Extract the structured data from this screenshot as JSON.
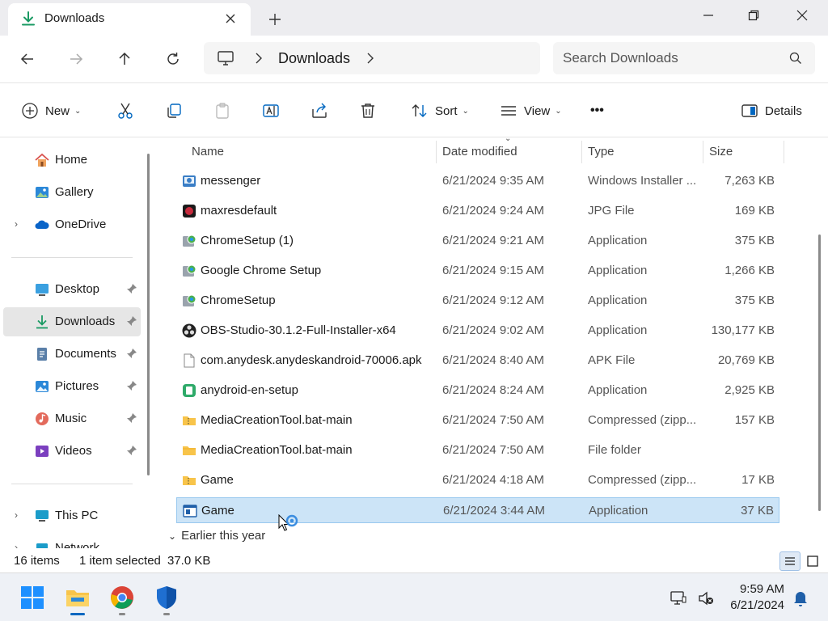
{
  "window": {
    "tab_title": "Downloads",
    "new_tab_symbol": "+"
  },
  "address": {
    "location": "Downloads",
    "search_placeholder": "Search Downloads"
  },
  "toolbar": {
    "new_label": "New",
    "sort_label": "Sort",
    "view_label": "View",
    "more_label": "•••",
    "details_label": "Details"
  },
  "sidebar": {
    "home": "Home",
    "gallery": "Gallery",
    "onedrive": "OneDrive",
    "desktop": "Desktop",
    "downloads": "Downloads",
    "documents": "Documents",
    "pictures": "Pictures",
    "music": "Music",
    "videos": "Videos",
    "thispc": "This PC",
    "network": "Network"
  },
  "columns": {
    "name": "Name",
    "date": "Date modified",
    "type": "Type",
    "size": "Size"
  },
  "files": [
    {
      "name": "messenger",
      "date": "6/21/2024 9:35 AM",
      "type": "Windows Installer ...",
      "size": "7,263 KB",
      "icon": "installer-icon"
    },
    {
      "name": "maxresdefault",
      "date": "6/21/2024 9:24 AM",
      "type": "JPG File",
      "size": "169 KB",
      "icon": "image-file-icon"
    },
    {
      "name": "ChromeSetup (1)",
      "date": "6/21/2024 9:21 AM",
      "type": "Application",
      "size": "375 KB",
      "icon": "setup-app-icon"
    },
    {
      "name": "Google Chrome Setup",
      "date": "6/21/2024 9:15 AM",
      "type": "Application",
      "size": "1,266 KB",
      "icon": "setup-app-icon"
    },
    {
      "name": "ChromeSetup",
      "date": "6/21/2024 9:12 AM",
      "type": "Application",
      "size": "375 KB",
      "icon": "setup-app-icon"
    },
    {
      "name": "OBS-Studio-30.1.2-Full-Installer-x64",
      "date": "6/21/2024 9:02 AM",
      "type": "Application",
      "size": "130,177 KB",
      "icon": "obs-icon"
    },
    {
      "name": "com.anydesk.anydeskandroid-70006.apk",
      "date": "6/21/2024 8:40 AM",
      "type": "APK File",
      "size": "20,769 KB",
      "icon": "blank-file-icon"
    },
    {
      "name": "anydroid-en-setup",
      "date": "6/21/2024 8:24 AM",
      "type": "Application",
      "size": "2,925 KB",
      "icon": "anydroid-icon"
    },
    {
      "name": "MediaCreationTool.bat-main",
      "date": "6/21/2024 7:50 AM",
      "type": "Compressed (zipp...",
      "size": "157 KB",
      "icon": "zip-folder-icon"
    },
    {
      "name": "MediaCreationTool.bat-main",
      "date": "6/21/2024 7:50 AM",
      "type": "File folder",
      "size": "",
      "icon": "folder-icon"
    },
    {
      "name": "Game",
      "date": "6/21/2024 4:18 AM",
      "type": "Compressed (zipp...",
      "size": "17 KB",
      "icon": "zip-folder-icon"
    },
    {
      "name": "Game",
      "date": "6/21/2024 3:44 AM",
      "type": "Application",
      "size": "37 KB",
      "icon": "app-window-icon",
      "selected": true
    }
  ],
  "group_header": "Earlier this year",
  "status": {
    "items": "16 items",
    "selected": "1 item selected",
    "size": "37.0 KB"
  },
  "taskbar": {
    "time": "9:59 AM",
    "date": "6/21/2024"
  },
  "colors": {
    "accent": "#0067c0",
    "selection": "#cce4f7",
    "folder": "#f8c44a"
  }
}
